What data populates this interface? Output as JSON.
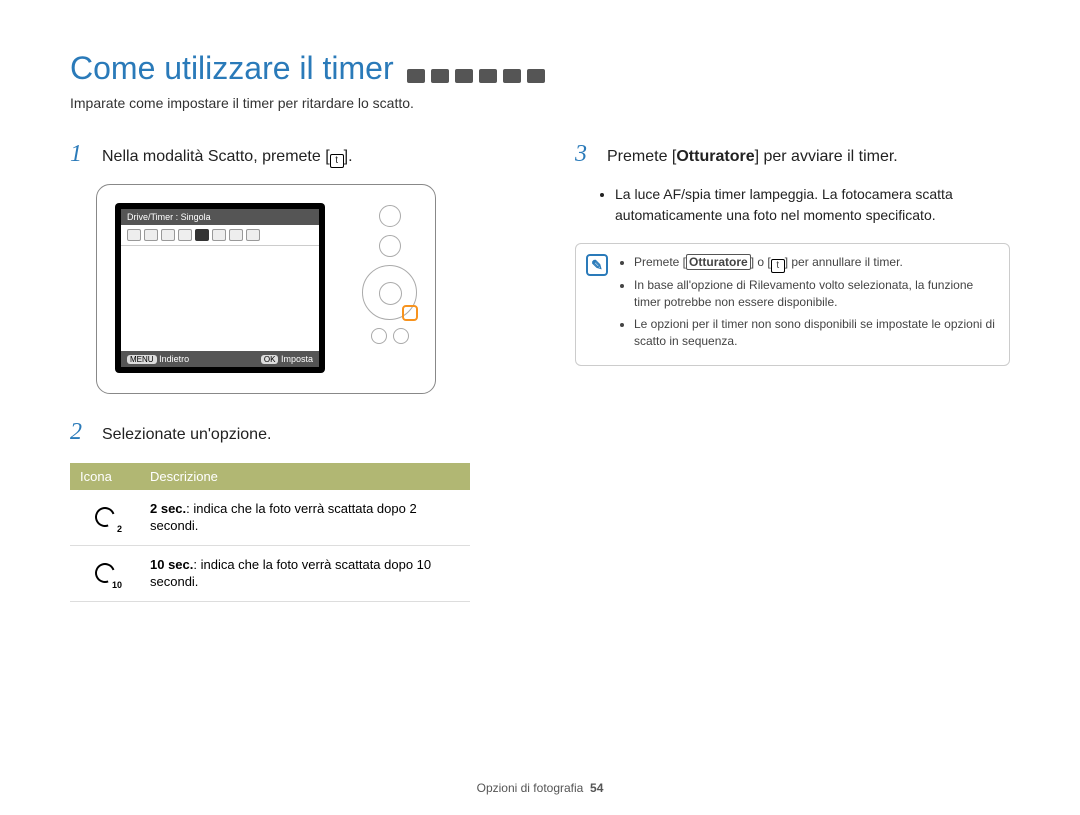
{
  "title": "Come utilizzare il timer",
  "subtitle": "Imparate come impostare il timer per ritardare lo scatto.",
  "step1": {
    "num": "1",
    "text_a": "Nella modalità Scatto, premete [",
    "text_b": "]."
  },
  "step2": {
    "num": "2",
    "text": "Selezionate un'opzione."
  },
  "step3": {
    "num": "3",
    "text_a": "Premete [",
    "bold": "Otturatore",
    "text_b": "] per avviare il timer.",
    "bullet": "La luce AF/spia timer lampeggia. La fotocamera scatta automaticamente una foto nel momento specificato."
  },
  "camera_screen": {
    "header": "Drive/Timer : Singola",
    "footer_back_label": "Indietro",
    "footer_back_pill": "MENU",
    "footer_set_label": "Imposta",
    "footer_set_pill": "OK"
  },
  "table": {
    "h1": "Icona",
    "h2": "Descrizione",
    "rows": [
      {
        "sub": "2",
        "bold": "2 sec.",
        "rest": ": indica che la foto verrà scattata dopo 2 secondi."
      },
      {
        "sub": "10",
        "bold": "10 sec.",
        "rest": ": indica che la foto verrà scattata dopo 10 secondi."
      }
    ]
  },
  "note": {
    "items": [
      {
        "a": "Premete [",
        "b": "Otturatore",
        "c": "] o [",
        "d": "] per annullare il timer."
      },
      {
        "full": "In base all'opzione di Rilevamento volto selezionata, la funzione timer potrebbe non essere disponibile."
      },
      {
        "full": "Le opzioni per il timer non sono disponibili se impostate le opzioni di scatto in sequenza."
      }
    ]
  },
  "footer": {
    "section": "Opzioni di fotografia",
    "page": "54"
  }
}
